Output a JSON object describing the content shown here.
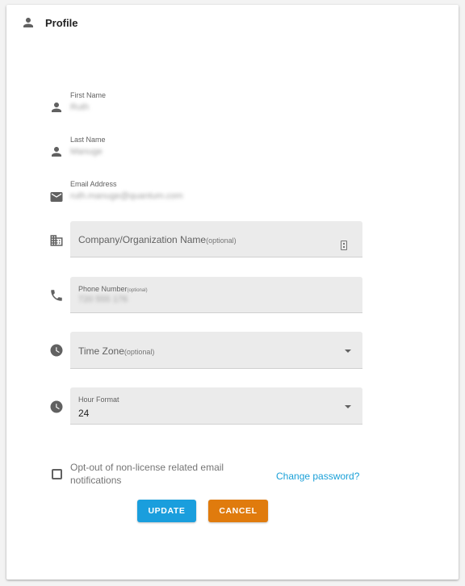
{
  "header": {
    "title": "Profile",
    "icon": "person-icon"
  },
  "fields": {
    "first_name": {
      "label": "First Name",
      "value": "Ruth",
      "icon": "person-icon"
    },
    "last_name": {
      "label": "Last Name",
      "value": "Manuge",
      "icon": "person-icon"
    },
    "email": {
      "label": "Email Address",
      "value": "ruth.manuge@quantum.com",
      "icon": "email-icon"
    },
    "company": {
      "placeholder": "Company/Organization Name",
      "optional": "(optional)",
      "icon": "business-icon",
      "trailing_icon": "contact-card-icon"
    },
    "phone": {
      "label": "Phone Number",
      "optional": "(optional)",
      "value": "720 555 176",
      "icon": "phone-icon"
    },
    "time_zone": {
      "placeholder": "Time Zone",
      "optional": "(optional)",
      "icon": "clock-icon"
    },
    "hour_format": {
      "label": "Hour Format",
      "value": "24",
      "icon": "clock-icon"
    }
  },
  "opt_out": {
    "label": "Opt-out of non-license related email notifications",
    "checked": false
  },
  "change_password_label": "Change password?",
  "buttons": {
    "update": "UPDATE",
    "cancel": "CANCEL"
  },
  "colors": {
    "primary": "#1a9edd",
    "cancel": "#e07b0d",
    "link": "#1aa0d8",
    "field_bg": "#ebebeb"
  }
}
